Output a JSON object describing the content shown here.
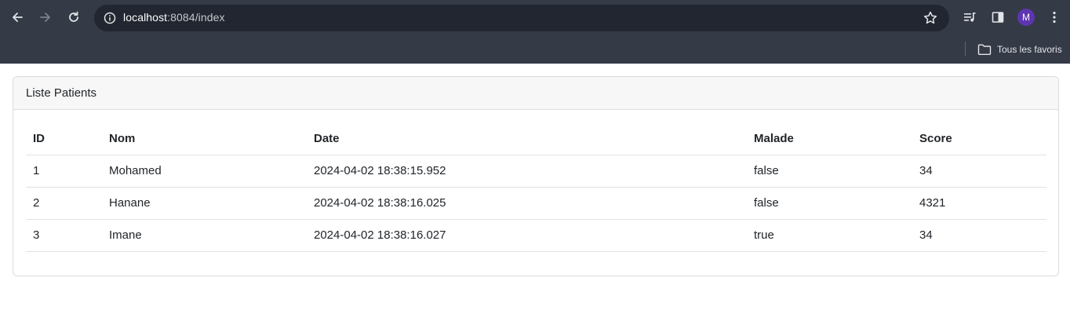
{
  "browser": {
    "url_host": "localhost",
    "url_path": ":8084/index",
    "profile_initial": "M",
    "bookmarks_folder_label": "Tous les favoris"
  },
  "card": {
    "title": "Liste Patients"
  },
  "table": {
    "headers": [
      "ID",
      "Nom",
      "Date",
      "Malade",
      "Score"
    ],
    "rows": [
      [
        "1",
        "Mohamed",
        "2024-04-02 18:38:15.952",
        "false",
        "34"
      ],
      [
        "2",
        "Hanane",
        "2024-04-02 18:38:16.025",
        "false",
        "4321"
      ],
      [
        "3",
        "Imane",
        "2024-04-02 18:38:16.027",
        "true",
        "34"
      ]
    ]
  }
}
